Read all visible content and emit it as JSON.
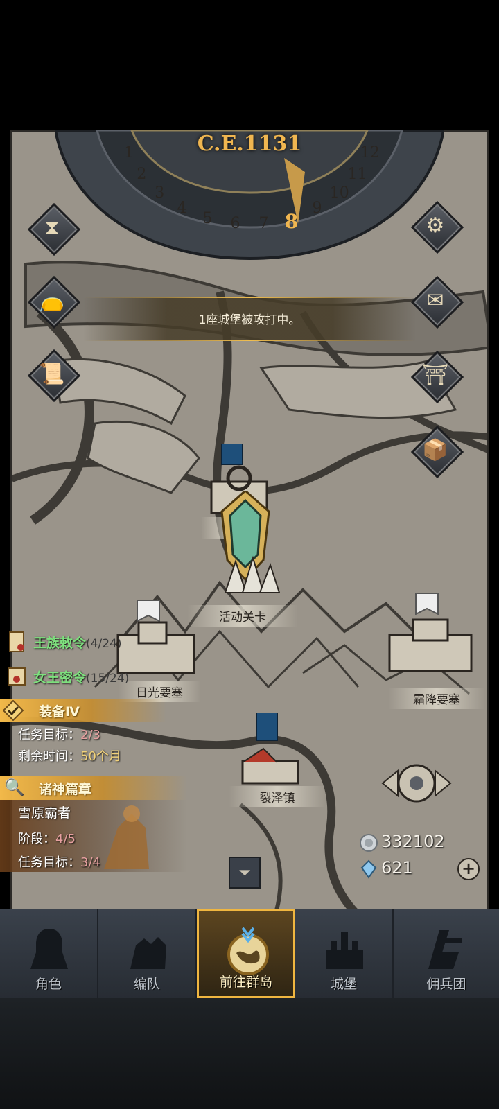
{
  "calendar": {
    "year": "C.E.1131",
    "months": [
      "1",
      "2",
      "3",
      "4",
      "5",
      "6",
      "7",
      "8",
      "9",
      "10",
      "11",
      "12"
    ],
    "current_month": "8"
  },
  "banner": {
    "text": "1座城堡被攻打中。"
  },
  "map": {
    "labels": {
      "event_stage": "活动关卡",
      "sunlight_fortress": "日光要塞",
      "frost_fortress": "霜降要塞",
      "rift_town": "裂泽镇",
      "frost_partial": "霜"
    }
  },
  "quests": {
    "royal_decree": {
      "title": "王族敕令",
      "count": "(4/24)"
    },
    "queen_order": {
      "title": "女王密令",
      "count": "(15/24)"
    },
    "equipment": {
      "title": "装备Ⅳ",
      "target_label": "任务目标：",
      "target_value": "2/3",
      "time_label": "剩余时间：",
      "time_value": "50个月"
    },
    "gods_chapter": {
      "title": "诸神篇章",
      "subtitle": "雪原霸者",
      "stage_label": "阶段：",
      "stage_value": "4/5",
      "target_label": "任务目标：",
      "target_value": "3/4"
    }
  },
  "resources": {
    "silver": "332102",
    "crystals": "621"
  },
  "nav": {
    "items": [
      {
        "label": "角色",
        "icon": "knight-icon"
      },
      {
        "label": "编队",
        "icon": "troops-icon"
      },
      {
        "label": "前往群岛",
        "icon": "islands-icon"
      },
      {
        "label": "城堡",
        "icon": "castle-icon"
      },
      {
        "label": "佣兵团",
        "icon": "mercenary-icon"
      }
    ],
    "active_index": 2
  },
  "colors": {
    "accent": "#f0b640",
    "quest_green": "#7ee07e",
    "gold_text": "#f0b650"
  }
}
